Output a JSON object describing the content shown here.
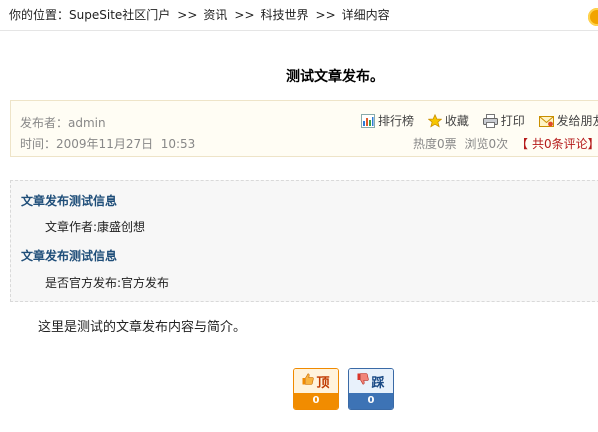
{
  "breadcrumb": {
    "prefix": "你的位置：",
    "sep": ">>",
    "items": [
      "SupeSite社区门户",
      "资讯",
      "科技世界",
      "详细内容"
    ]
  },
  "article": {
    "title": "测试文章发布。",
    "author_label": "发布者：",
    "author": "admin",
    "time_label": "时间：",
    "time": "2009年11月27日  10:53"
  },
  "toolbar": {
    "items": [
      {
        "label": "排行榜",
        "icon": "bar-chart-icon"
      },
      {
        "label": "收藏",
        "icon": "star-icon"
      },
      {
        "label": "打印",
        "icon": "printer-icon"
      },
      {
        "label": "发给朋友",
        "icon": "envelope-icon"
      }
    ]
  },
  "stats": {
    "heat": "热度0票",
    "views": "浏览0次",
    "comments_open": "【",
    "comments_link": "共0条评论",
    "comments_close": "】"
  },
  "fields": [
    {
      "title": "文章发布测试信息",
      "value": "文章作者:康盛创想"
    },
    {
      "title": "文章发布测试信息",
      "value": "是否官方发布:官方发布"
    }
  ],
  "content": "这里是测试的文章发布内容与简介。",
  "vote": {
    "up_label": "顶",
    "up_count": "0",
    "up_icon": "thumbs-up-icon",
    "down_label": "踩",
    "down_count": "0",
    "down_icon": "thumbs-down-icon",
    "up_color": "#f18c00",
    "down_color": "#3d73b5"
  }
}
